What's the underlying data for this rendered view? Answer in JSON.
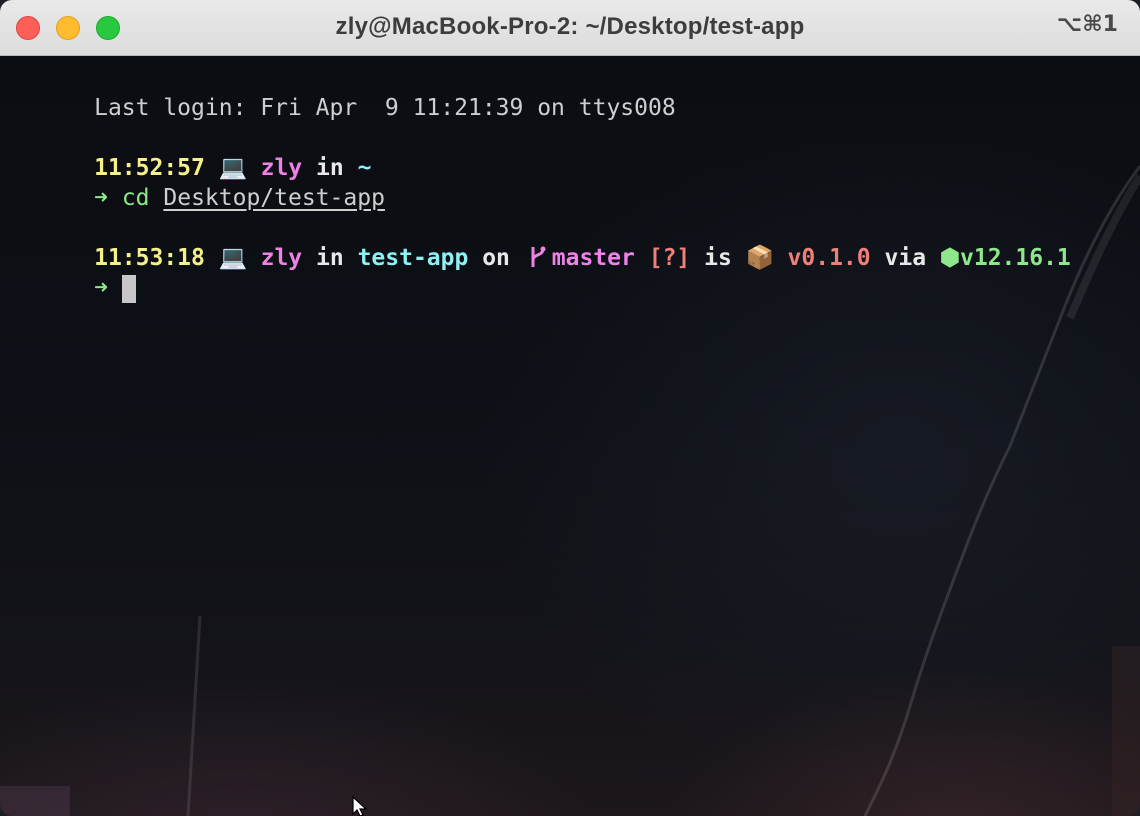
{
  "window": {
    "title": "zly@MacBook-Pro-2: ~/Desktop/test-app",
    "shortcut": "⌥⌘1"
  },
  "terminal": {
    "last_login": "Last login: Fri Apr  9 11:21:39 on ttys008",
    "prompt1": {
      "time": "11:52:57",
      "laptop_icon": "💻",
      "user": "zly",
      "in_word": "in",
      "dir": "~"
    },
    "command1": {
      "arrow": "➜",
      "cmd": "cd",
      "arg": "Desktop/test-app"
    },
    "prompt2": {
      "time": "11:53:18",
      "laptop_icon": "💻",
      "user": "zly",
      "in_word": "in",
      "dir": "test-app",
      "on_word": "on",
      "branch_icon": "git-branch-icon",
      "branch": "master",
      "git_status": "[?]",
      "is_word": "is",
      "package_icon": "📦",
      "version": "v0.1.0",
      "via_word": "via",
      "node_icon": "⬢",
      "node_version": "v12.16.1"
    },
    "prompt_arrow": "➜"
  },
  "colors": {
    "time": "#f4f08a",
    "user": "#ef82e6",
    "dir": "#8ff0f3",
    "arrow": "#8de88b",
    "version": "#f07f78",
    "node": "#8de88b"
  }
}
